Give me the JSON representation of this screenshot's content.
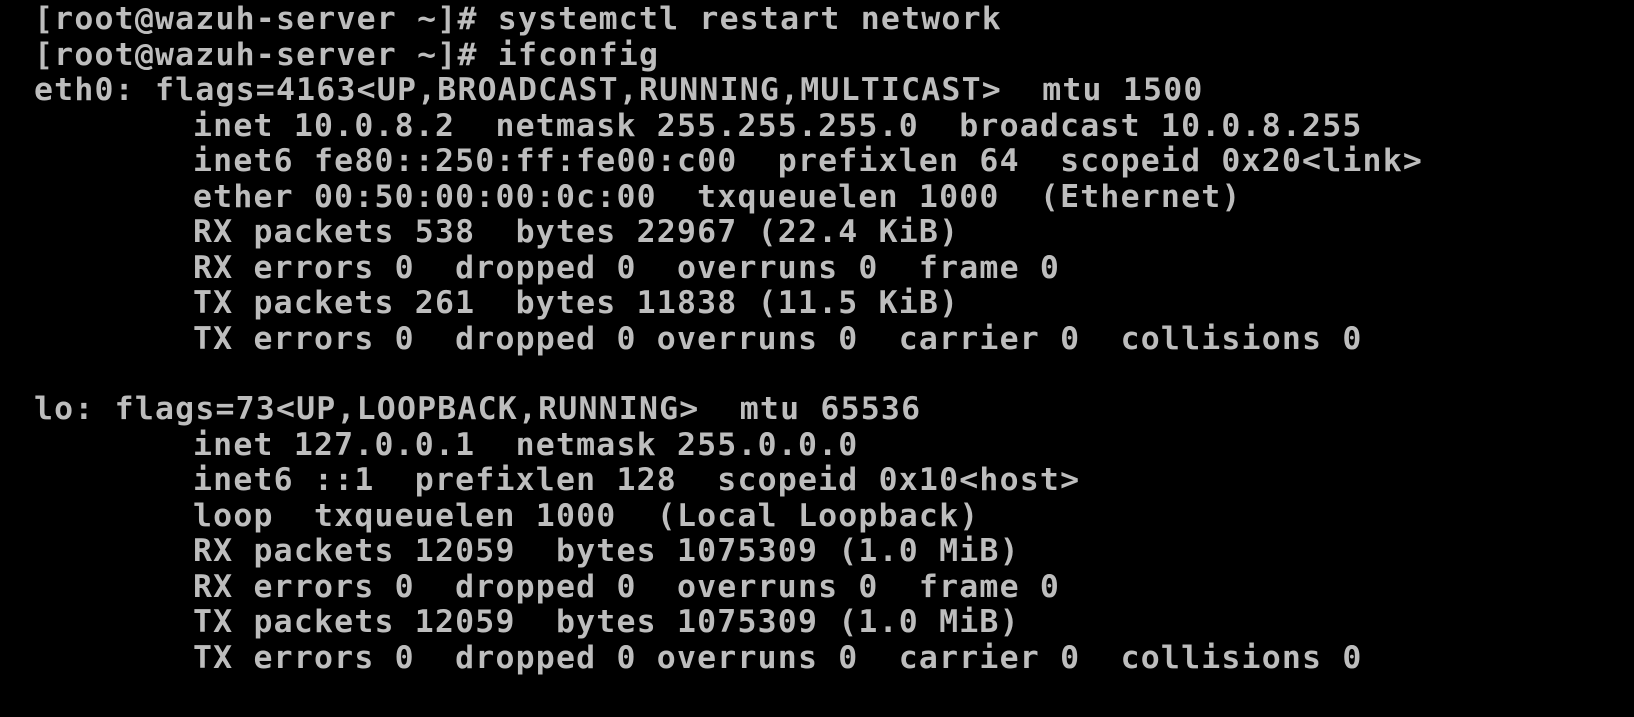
{
  "terminal": {
    "lines": [
      "[root@wazuh-server ~]# systemctl restart network",
      "[root@wazuh-server ~]# ifconfig",
      "eth0: flags=4163<UP,BROADCAST,RUNNING,MULTICAST>  mtu 1500",
      "inet 10.0.8.2  netmask 255.255.255.0  broadcast 10.0.8.255",
      "inet6 fe80::250:ff:fe00:c00  prefixlen 64  scopeid 0x20<link>",
      "ether 00:50:00:00:0c:00  txqueuelen 1000  (Ethernet)",
      "RX packets 538  bytes 22967 (22.4 KiB)",
      "RX errors 0  dropped 0  overruns 0  frame 0",
      "TX packets 261  bytes 11838 (11.5 KiB)",
      "TX errors 0  dropped 0 overruns 0  carrier 0  collisions 0",
      "",
      "lo: flags=73<UP,LOOPBACK,RUNNING>  mtu 65536",
      "inet 127.0.0.1  netmask 255.0.0.0",
      "inet6 ::1  prefixlen 128  scopeid 0x10<host>",
      "loop  txqueuelen 1000  (Local Loopback)",
      "RX packets 12059  bytes 1075309 (1.0 MiB)",
      "RX errors 0  dropped 0  overruns 0  frame 0",
      "TX packets 12059  bytes 1075309 (1.0 MiB)",
      "TX errors 0  dropped 0 overruns 0  carrier 0  collisions 0"
    ]
  }
}
